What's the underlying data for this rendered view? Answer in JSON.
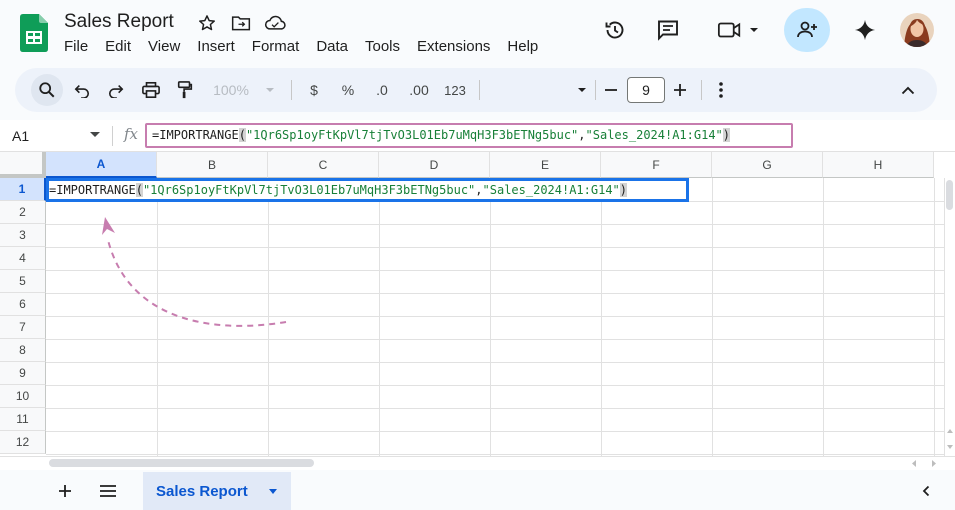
{
  "app": {
    "doc_title": "Sales Report",
    "menu": [
      "File",
      "Edit",
      "View",
      "Insert",
      "Format",
      "Data",
      "Tools",
      "Extensions",
      "Help"
    ]
  },
  "toolbar": {
    "zoom": "100%",
    "currency": "$",
    "percent": "%",
    "decrease_decimal": ".0",
    "increase_decimal": ".00",
    "number_format": "123",
    "font_size": "9"
  },
  "formula_bar": {
    "cell_ref": "A1",
    "fx": "fx",
    "formula_fn": "=IMPORTRANGE",
    "formula_open": "(",
    "formula_arg1": "\"1Qr6Sp1oyFtKpVl7tjTvO3L01Eb7uMqH3F3bETNg5buc\"",
    "formula_comma": ",",
    "formula_arg2": "\"Sales_2024!A1:G14\"",
    "formula_close": ")"
  },
  "grid": {
    "columns": [
      "A",
      "B",
      "C",
      "D",
      "E",
      "F",
      "G",
      "H"
    ],
    "rows": [
      "1",
      "2",
      "3",
      "4",
      "5",
      "6",
      "7",
      "8",
      "9",
      "10",
      "11",
      "12"
    ]
  },
  "sheet_tabs": {
    "active": "Sales Report"
  },
  "colors": {
    "accent_blue": "#0b57d0",
    "selection": "#1a73e8",
    "formula_highlight": "#c77daf",
    "string_green": "#188038",
    "share_bg": "#c2e7ff",
    "sheets_green": "#0f9d58"
  }
}
